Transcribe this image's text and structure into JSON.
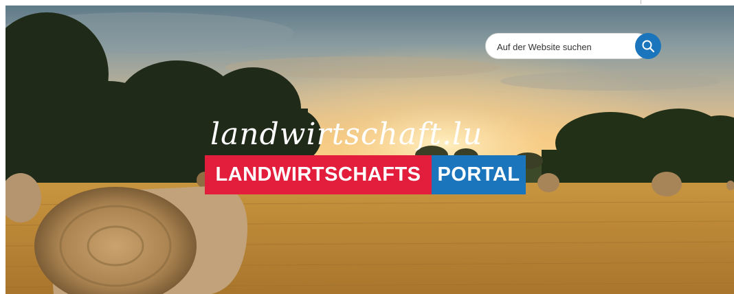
{
  "search": {
    "placeholder": "Auf der Website suchen"
  },
  "logo": {
    "script_text": "landwirtschaft.lu",
    "red_text": "LANDWIRTSCHAFTS",
    "blue_text": "PORTAL",
    "red_color": "#e31d3c",
    "blue_color": "#1b75bc"
  },
  "icons": {
    "search": "search-icon"
  }
}
